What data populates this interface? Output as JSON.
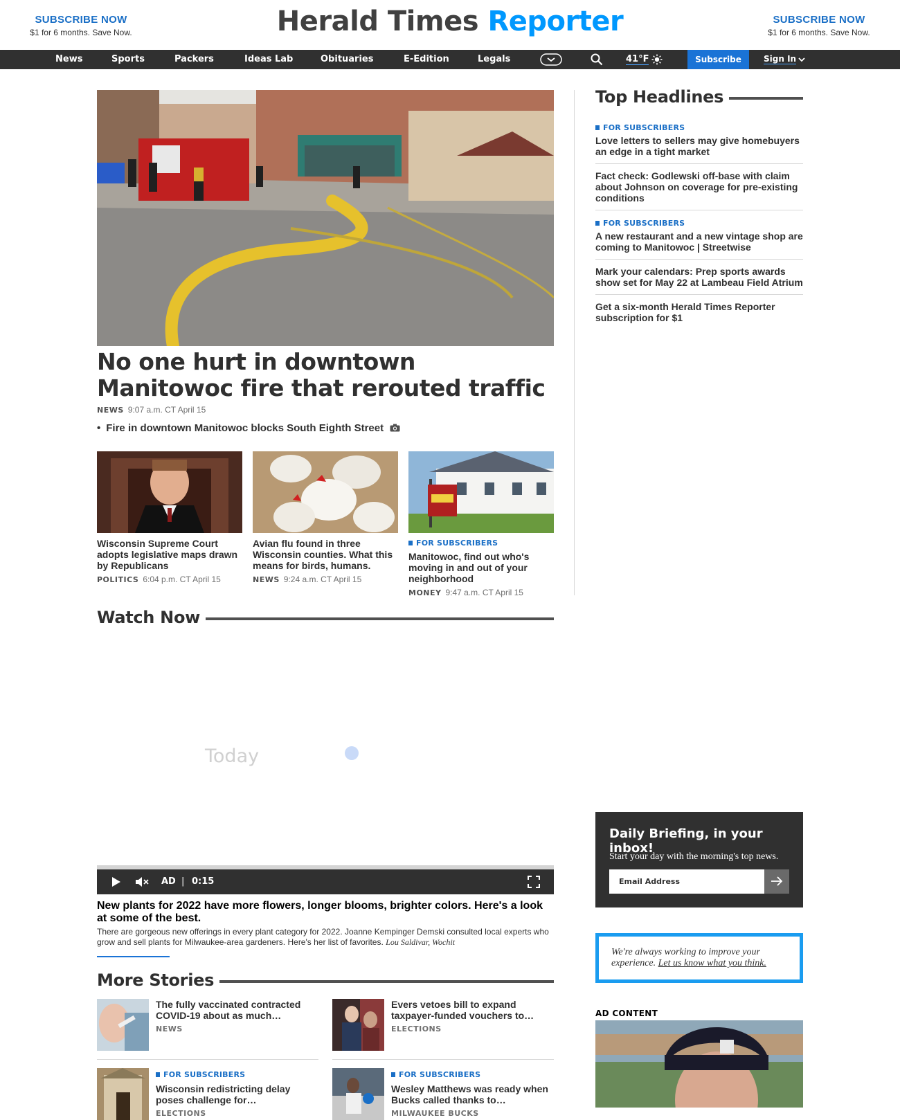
{
  "promo_left": {
    "title": "SUBSCRIBE NOW",
    "sub": "$1 for 6 months. Save Now."
  },
  "promo_right": {
    "title": "SUBSCRIBE NOW",
    "sub": "$1 for 6 months. Save Now."
  },
  "masthead": {
    "part1": "Herald Times",
    "part2": "Reporter"
  },
  "nav": {
    "items": [
      "News",
      "Sports",
      "Packers",
      "Ideas Lab",
      "Obituaries",
      "E-Edition",
      "Legals"
    ],
    "temperature": "41°F",
    "subscribe": "Subscribe",
    "signin": "Sign In"
  },
  "hero": {
    "title": "No one hurt in downtown Manitowoc fire that rerouted traffic",
    "label": "NEWS",
    "time": "9:07 a.m. CT April 15",
    "related": "Fire in downtown Manitowoc blocks South Eighth Street"
  },
  "cards": [
    {
      "title": "Wisconsin Supreme Court adopts legislative maps drawn by Republicans",
      "label": "POLITICS",
      "time": "6:04 p.m. CT April 15",
      "tag": ""
    },
    {
      "title": "Avian flu found in three Wisconsin counties. What this means for birds, humans.",
      "label": "NEWS",
      "time": "9:24 a.m. CT April 15",
      "tag": ""
    },
    {
      "title": "Manitowoc, find out who's moving in and out of your neighborhood",
      "label": "MONEY",
      "time": "9:47 a.m. CT April 15",
      "tag": "FOR SUBSCRIBERS"
    }
  ],
  "top_headlines": {
    "heading": "Top Headlines",
    "items": [
      {
        "tag": "FOR SUBSCRIBERS",
        "title": "Love letters to sellers may give homebuyers an edge in a tight market"
      },
      {
        "tag": "",
        "title": "Fact check: Godlewski off-base with claim about Johnson on coverage for pre-existing conditions"
      },
      {
        "tag": "FOR SUBSCRIBERS",
        "title": "A new restaurant and a new vintage shop are coming to Manitowoc | Streetwise"
      },
      {
        "tag": "",
        "title": "Mark your calendars: Prep sports awards show set for May 22 at Lambeau Field Atrium"
      },
      {
        "tag": "",
        "title": "Get a six-month Herald Times Reporter subscription for $1"
      }
    ]
  },
  "watch_now": {
    "heading": "Watch Now",
    "watermark": "Today",
    "controls": {
      "ad": "AD",
      "sep": "|",
      "time": "0:15"
    },
    "title": "New plants for 2022 have more flowers, longer blooms, brighter colors. Here's a look at some of the best.",
    "description": "There are gorgeous new offerings in every plant category for 2022. Joanne Kempinger Demski consulted local experts who grow and sell plants for Milwaukee-area gardeners. Here's her list of favorites.",
    "credit": "Lou Saldivar, Wochit"
  },
  "more_stories": {
    "heading": "More Stories",
    "items": [
      {
        "tag": "",
        "title": "The fully vaccinated contracted COVID-19 about as much…",
        "label": "NEWS"
      },
      {
        "tag": "",
        "title": "Evers vetoes bill to expand taxpayer-funded vouchers to…",
        "label": "ELECTIONS"
      },
      {
        "tag": "FOR SUBSCRIBERS",
        "title": "Wisconsin redistricting delay poses challenge for…",
        "label": "ELECTIONS"
      },
      {
        "tag": "FOR SUBSCRIBERS",
        "title": "Wesley Matthews was ready when Bucks called thanks to…",
        "label": "MILWAUKEE BUCKS"
      }
    ]
  },
  "newsletter": {
    "title": "Daily Briefing, in your inbox!",
    "sub": "Start your day with the morning's top news.",
    "placeholder": "Email Address"
  },
  "feedback": {
    "text": "We're always working to improve your experience.",
    "link": "Let us know what you think."
  },
  "ad": {
    "label": "AD CONTENT"
  },
  "colors": {
    "accent": "#1a73d6",
    "brand_blue": "#0098fe",
    "nav_bg": "#303030",
    "feedback_border": "#1a9cf0"
  }
}
